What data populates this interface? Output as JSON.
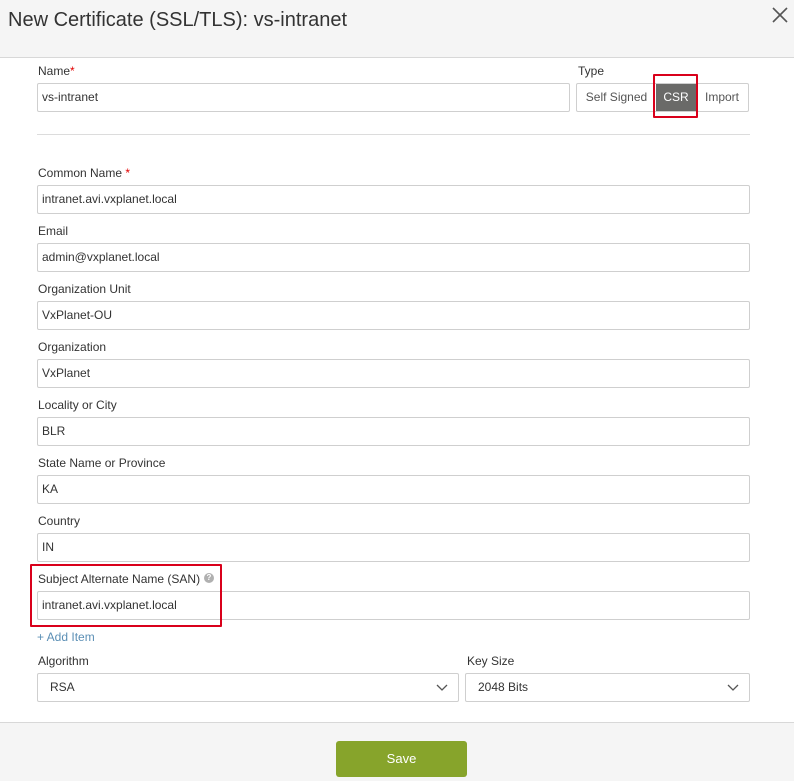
{
  "dialog": {
    "title": "New Certificate (SSL/TLS): vs-intranet"
  },
  "name_field": {
    "label": "Name",
    "required_mark": "*",
    "value": "vs-intranet"
  },
  "type_field": {
    "label": "Type",
    "options": [
      "Self Signed",
      "CSR",
      "Import"
    ],
    "selected": "CSR"
  },
  "fields": {
    "common_name": {
      "label": "Common Name",
      "required_mark": "*",
      "value": "intranet.avi.vxplanet.local"
    },
    "email": {
      "label": "Email",
      "value": "admin@vxplanet.local"
    },
    "org_unit": {
      "label": "Organization Unit",
      "value": "VxPlanet-OU"
    },
    "organization": {
      "label": "Organization",
      "value": "VxPlanet"
    },
    "locality": {
      "label": "Locality or City",
      "value": "BLR"
    },
    "state": {
      "label": "State Name or Province",
      "value": "KA"
    },
    "country": {
      "label": "Country",
      "value": "IN"
    },
    "san": {
      "label": "Subject Alternate Name (SAN)",
      "help_icon": "help-icon",
      "value": "intranet.avi.vxplanet.local"
    }
  },
  "add_item_label": "+ Add Item",
  "algorithm": {
    "label": "Algorithm",
    "selected": "RSA"
  },
  "key_size": {
    "label": "Key Size",
    "selected": "2048 Bits"
  },
  "footer": {
    "save_label": "Save"
  },
  "colors": {
    "accent_save": "#87a42b",
    "selected_type": "#6a6a68",
    "required": "#e20000",
    "highlight_box": "#d9001b",
    "link": "#5b8fb5"
  }
}
